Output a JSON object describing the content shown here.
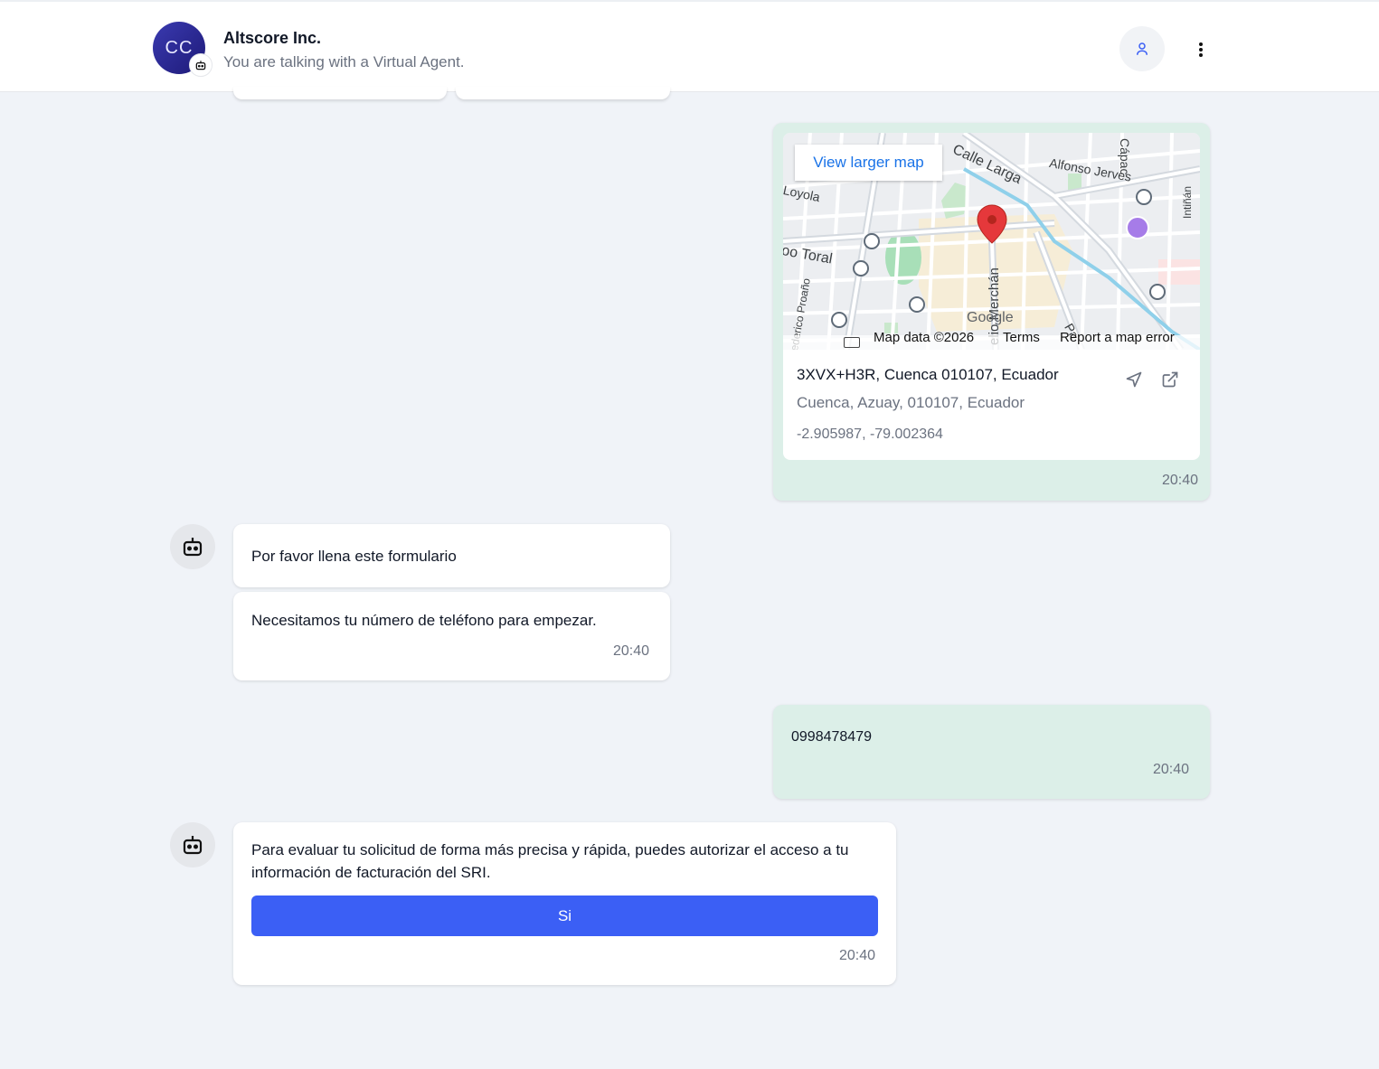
{
  "header": {
    "avatar_initials": "CC",
    "company_name": "Altscore Inc.",
    "subtitle": "You are talking with a Virtual Agent.",
    "icons": {
      "avatar_badge": "robot-icon",
      "user": "user-icon",
      "more": "more-vertical-icon"
    }
  },
  "map_message": {
    "view_larger_map": "View larger map",
    "map_labels": {
      "calle_larga": "Calle Larga",
      "alfonso_jerves": "Alfonso Jerves",
      "capac": "Cápac",
      "intinan": "Intiñán",
      "loyola": "Loyola",
      "toral": "oo Toral",
      "merchan": "elio Merchán",
      "proano": "ederico Proaño",
      "pa": "Pa"
    },
    "google_logo": "Google",
    "map_data": "Map data ©2026",
    "terms": "Terms",
    "report_error": "Report a map error",
    "address_line": "3XVX+H3R, Cuenca 010107, Ecuador",
    "address_detail": "Cuenca, Azuay, 010107, Ecuador",
    "coordinates": "-2.905987, -79.002364",
    "time": "20:40",
    "icons": {
      "navigate": "navigation-arrow-icon",
      "open": "external-link-icon",
      "pin": "map-pin-icon"
    }
  },
  "bot_message_1": {
    "text": "Por favor llena este formulario"
  },
  "bot_message_2": {
    "text": "Necesitamos tu número de teléfono para empezar.",
    "time": "20:40"
  },
  "user_message": {
    "text": "0998478479",
    "time": "20:40"
  },
  "bot_message_3": {
    "text_line1": "Para evaluar tu solicitud de forma más precisa y rápida, puedes autorizar el acceso a tu",
    "text_line2": "información de facturación del SRI.",
    "button_label": "Si",
    "time": "20:40"
  },
  "colors": {
    "primary_button": "#3b5ff5",
    "user_bubble": "#dcefe8",
    "background": "#f0f3f8",
    "avatar": "#2a2894"
  }
}
